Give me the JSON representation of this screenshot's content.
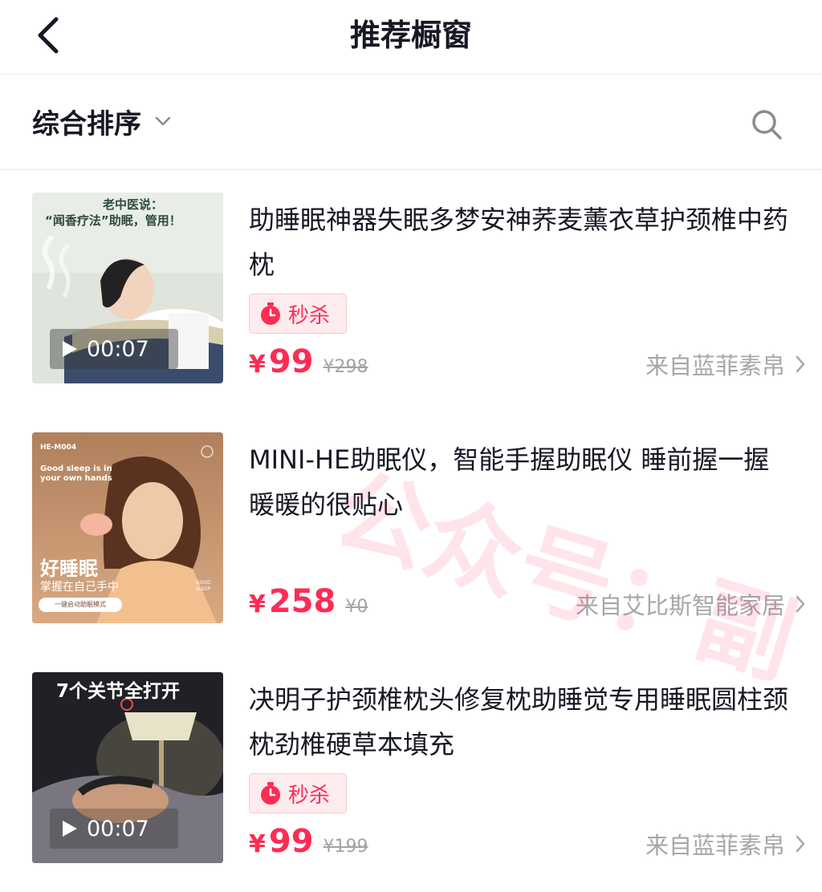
{
  "header": {
    "title": "推荐橱窗",
    "back_icon": "chevron-left-icon"
  },
  "sortbar": {
    "sort_label": "综合排序",
    "dropdown_icon": "chevron-down-icon",
    "search_icon": "search-icon"
  },
  "products": [
    {
      "name": "助睡眠神器失眠多梦安神荞麦薰衣草护颈椎中药枕",
      "flash_sale": "秒杀",
      "currency": "¥",
      "price": "99",
      "original_price": "¥298",
      "shop": "来自蓝菲素帛",
      "video_duration": "00:07",
      "thumb_heading": "老中医说：",
      "thumb_heading2": "“闻香疗法”助眠，管用！"
    },
    {
      "name": "MINI-HE助眠仪，智能手握助眠仪 睡前握一握暖暖的很贴心",
      "currency": "¥",
      "price": "258",
      "original_price": "¥0",
      "shop": "来自艾比斯智能家居",
      "thumb_model": "HE-M004",
      "thumb_tagline": "Good sleep is in your own hands",
      "thumb_title": "好睡眠",
      "thumb_subtitle": "掌握在自己手中",
      "thumb_button": "一键启动助眠模式",
      "thumb_brand": "GOOD SLEEP"
    },
    {
      "name": "决明子护颈椎枕头修复枕助睡觉专用睡眠圆柱颈枕劲椎硬草本填充",
      "flash_sale": "秒杀",
      "currency": "¥",
      "price": "99",
      "original_price": "¥199",
      "shop": "来自蓝菲素帛",
      "video_duration": "00:07",
      "thumb_heading": "7个关节全打开"
    }
  ],
  "watermark": "公众号：副",
  "colors": {
    "accent": "#fe2c55",
    "text": "#161823",
    "muted": "#a7a7ab",
    "divider": "#ececec"
  }
}
